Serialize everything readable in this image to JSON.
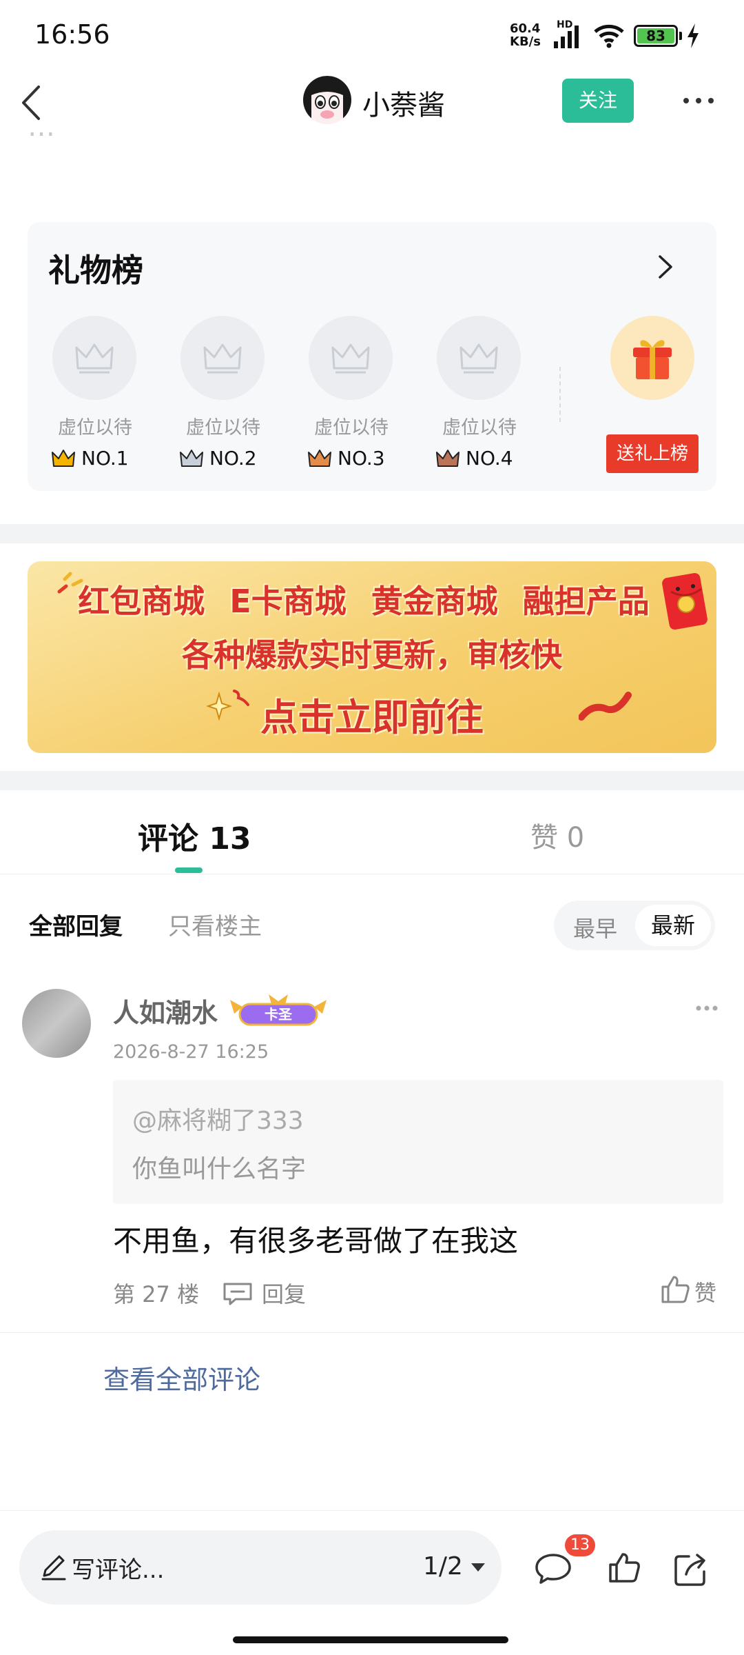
{
  "status_bar": {
    "time": "16:56",
    "net_speed_value": "60.4",
    "net_speed_unit": "KB/s",
    "net_type": "HD",
    "battery": "83"
  },
  "header": {
    "username": "小萘酱",
    "follow_label": "关注"
  },
  "post_fragment": "…",
  "gift_board": {
    "title": "礼物榜",
    "slots": [
      {
        "label": "虚位以待",
        "rank": "NO.1",
        "crown_color": "#f5b400"
      },
      {
        "label": "虚位以待",
        "rank": "NO.2",
        "crown_color": "#c8cfd8"
      },
      {
        "label": "虚位以待",
        "rank": "NO.3",
        "crown_color": "#e48d4a"
      },
      {
        "label": "虚位以待",
        "rank": "NO.4",
        "crown_color": "#b9745a"
      }
    ],
    "send_gift_label": "送礼上榜"
  },
  "banner": {
    "line1": "红包商城 E卡商城 黄金商城 融担产品",
    "line2": "各种爆款实时更新，审核快",
    "line3": "点击立即前往"
  },
  "tabs": {
    "comments": "评论 13",
    "likes": "赞 0"
  },
  "filter": {
    "all": "全部回复",
    "op_only": "只看楼主",
    "earliest": "最早",
    "newest": "最新"
  },
  "comment": {
    "user": "人如潮水",
    "badge": "卡圣",
    "time": "2026-8-27 16:25",
    "quote_user": "@麻将糊了333",
    "quote_text": "你鱼叫什么名字",
    "text": "不用鱼，有很多老哥做了在我这",
    "floor": "第 27 楼",
    "reply_label": "回复",
    "like_label": "赞"
  },
  "view_all": "查看全部评论",
  "bottom_bar": {
    "write_placeholder": "写评论...",
    "page": "1/2",
    "comment_count": "13"
  },
  "colors": {
    "accent": "#2bbd97",
    "danger": "#e93b2a",
    "link": "#4f6b9d"
  }
}
